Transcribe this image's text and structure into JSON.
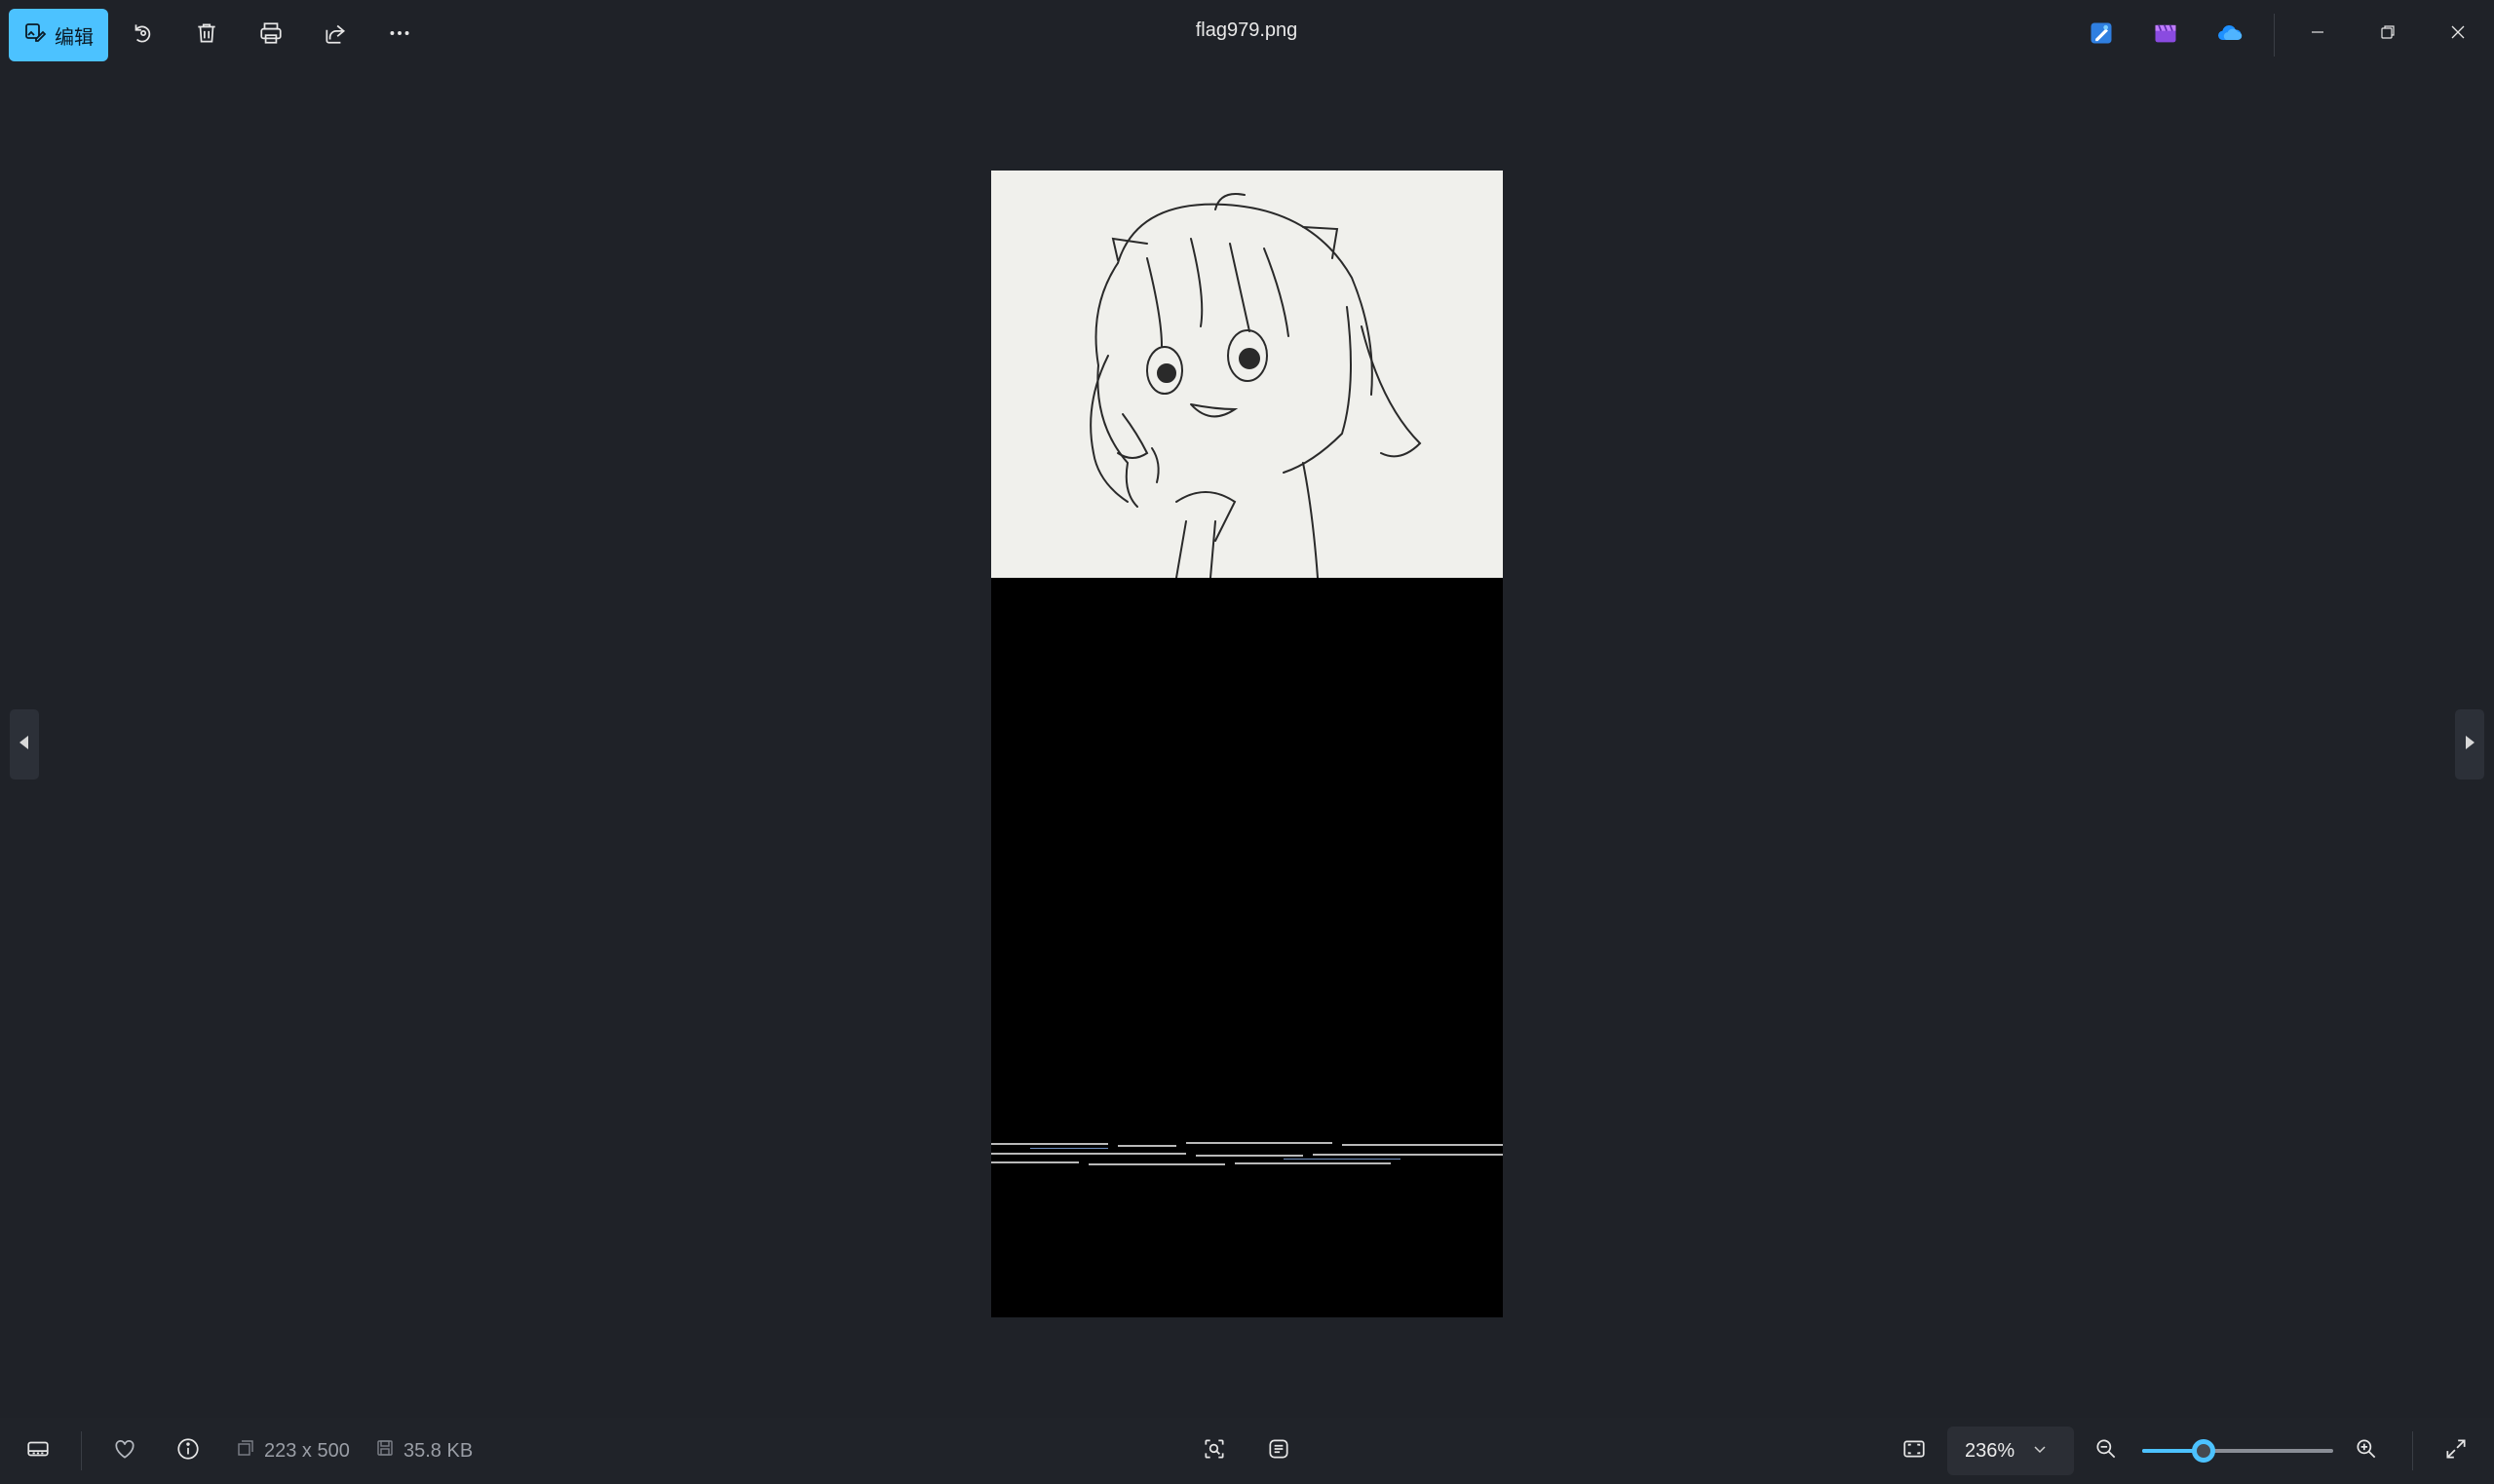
{
  "toolbar": {
    "edit_label": "编辑",
    "edit_icon": "edit-image-icon",
    "actions": [
      "rotate-icon",
      "delete-icon",
      "print-icon",
      "share-icon",
      "more-icon"
    ]
  },
  "window": {
    "title": "flag979.png",
    "app_icons": [
      "designer-icon",
      "clipchamp-icon",
      "onedrive-icon"
    ],
    "controls": [
      "minimize-icon",
      "restore-icon",
      "close-icon"
    ]
  },
  "viewer": {
    "prev_icon": "chevron-left-icon",
    "next_icon": "chevron-right-icon"
  },
  "statusbar": {
    "dimensions": "223 x 500",
    "file_size": "35.8 KB",
    "zoom": "236%",
    "zoom_slider_fraction": 0.32
  },
  "colors": {
    "accent": "#4cc2ff",
    "background": "#1f2228",
    "bar": "#202329"
  }
}
